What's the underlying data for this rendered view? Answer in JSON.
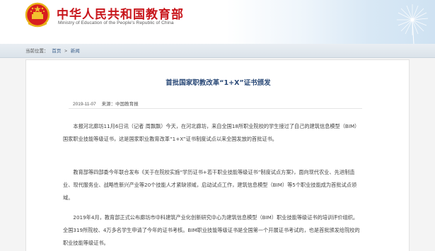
{
  "header": {
    "title": "中华人民共和国教育部",
    "subtitle": "Ministry of Education of the People's Republic of China"
  },
  "breadcrumb": {
    "label": "当前位置：",
    "home": "首页",
    "sep": ">",
    "section": "新闻"
  },
  "article": {
    "title": "首批国家职教改革“1+X”证书颁发",
    "date": "2019-11-07",
    "source": "来源：中国教育报",
    "paragraphs": [
      "本报河北廊坊11月6日讯（记者 周飘飘）今天，在河北廊坊，来自全国18所职业院校的学生接过了自己的建筑信息模型（BIM）国家职业技能等级证书，这是国家职业教育改革“1+X”证书制度试点以来全国发放的首批证书。",
      "教育部等四部委今年联合发布《关于在院校实施“学历证书+若干职业技能等级证书”制度试点方案》，面向现代农业、先进制造业、现代服务业、战略性新兴产业等20个技能人才紧缺领域，启动试点工作，建筑信息模型（BIM）等5个职业技能成为首批试点领域。",
      "2019年4月，教育部正式公布廊坊市中科建筑产业化创新研究中心为建筑信息模型（BIM）职业技能等级证书的培训评价组织。全国319所院校、4万多名学生申请了今年的证书考核。BIM职业技能等级证书是全国第一个开展证书考试的，也是首批颁发给院校的职业技能等级证书。"
    ]
  },
  "colors": {
    "brand_red": "#c8151b",
    "title_blue": "#2b4a78"
  },
  "icons": {
    "emblem": "national-emblem-icon",
    "decor": "dandelion-decoration"
  }
}
